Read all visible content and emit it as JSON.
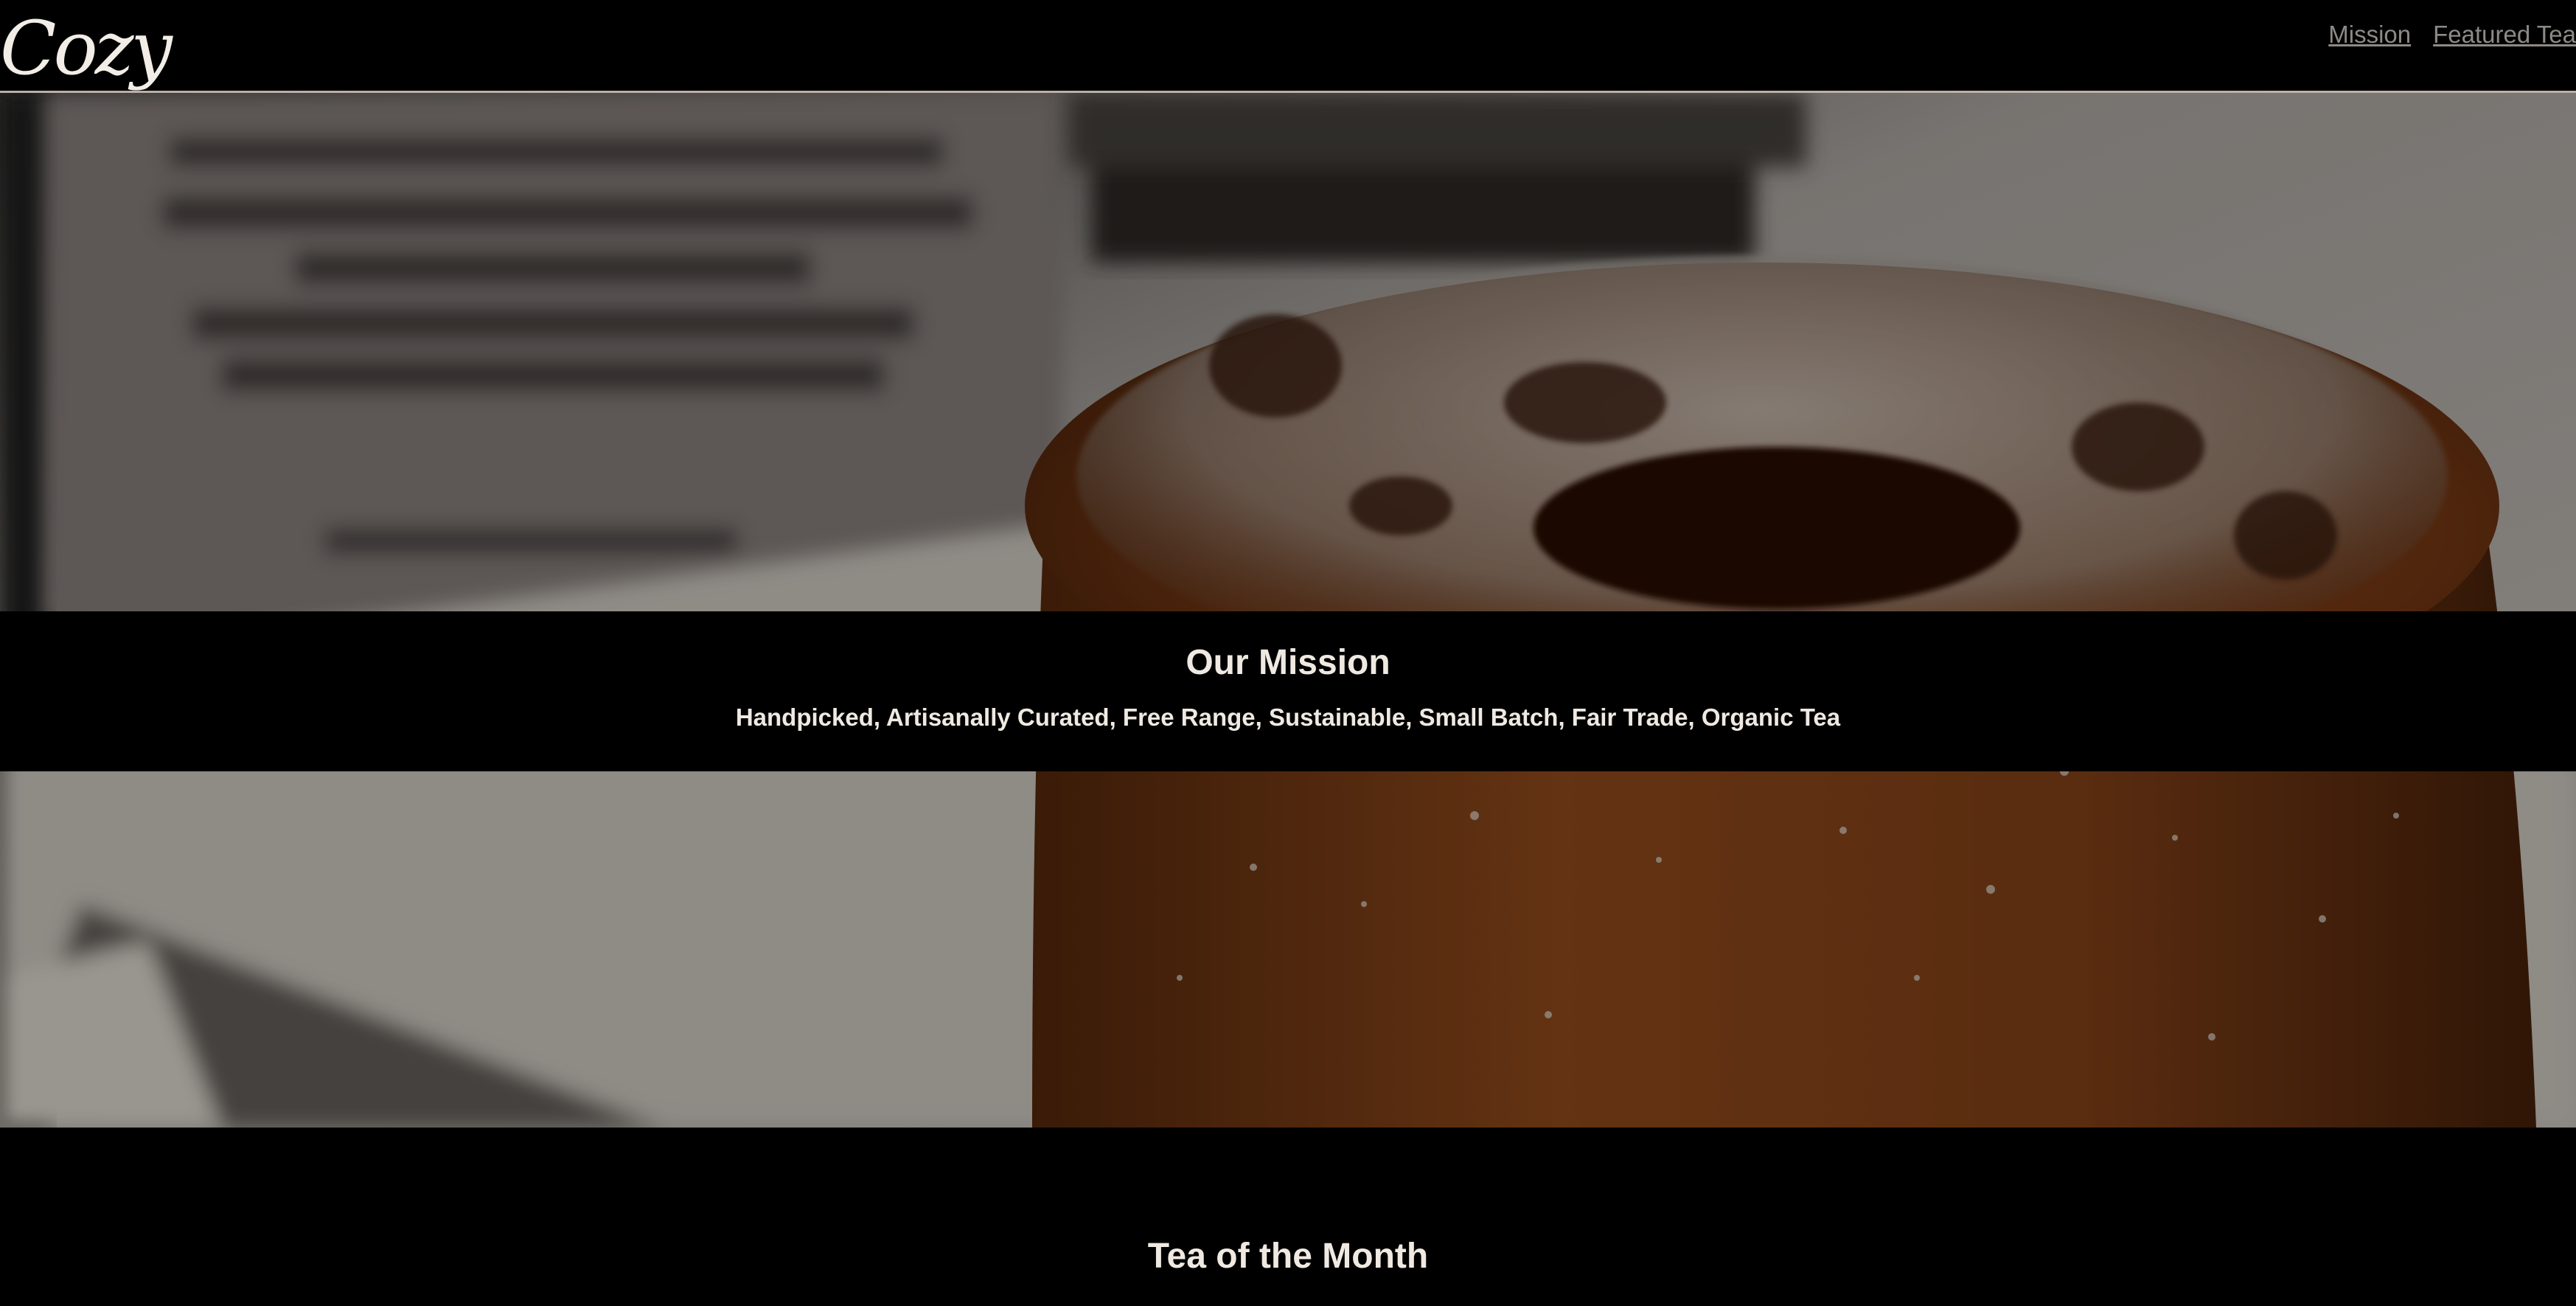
{
  "brand": {
    "logo_text": "Cozy"
  },
  "nav": {
    "items": [
      {
        "label": "Mission"
      },
      {
        "label": "Featured Tea"
      }
    ]
  },
  "hero": {
    "image_subject": "powdered-sugar-cake-photo"
  },
  "mission": {
    "title": "Our Mission",
    "tagline": "Handpicked, Artisanally Curated, Free Range, Sustainable, Small Batch, Fair Trade, Organic Tea"
  },
  "tea_section": {
    "title": "Tea of the Month"
  },
  "colors": {
    "background": "#000000",
    "text_light": "#efe9e2",
    "nav_link": "#8d8a86",
    "header_rule": "#b9b0a8"
  }
}
